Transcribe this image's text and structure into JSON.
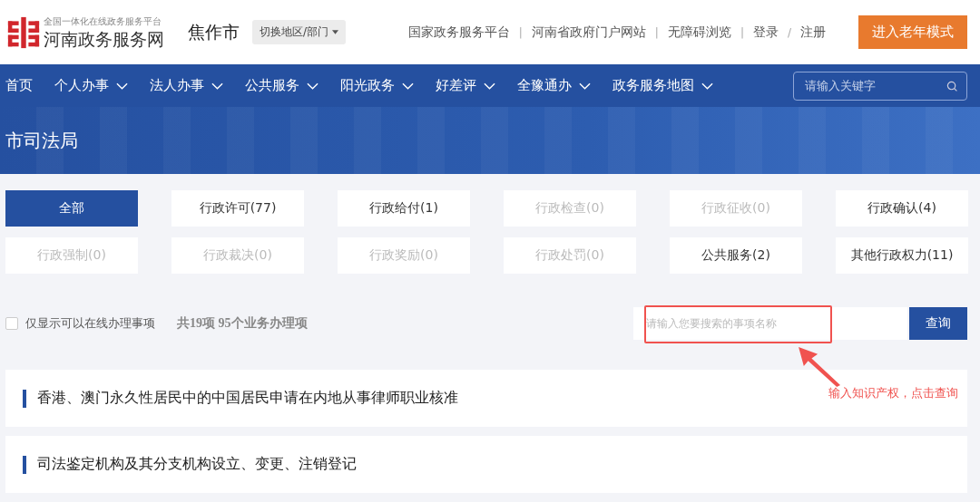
{
  "header": {
    "logo_subtitle": "全国一体化在线政务服务平台",
    "logo_title": "河南政务服务网",
    "city": "焦作市",
    "switch_button": "切换地区/部门",
    "links": [
      {
        "label": "国家政务服务平台",
        "separator": "|"
      },
      {
        "label": "河南省政府门户网站",
        "separator": "|"
      },
      {
        "label": "无障碍浏览",
        "separator": "|"
      },
      {
        "label": "登录",
        "separator": "/"
      },
      {
        "label": "注册"
      }
    ],
    "elder_button": "进入老年模式"
  },
  "nav": {
    "items": [
      {
        "label": "首页",
        "dropdown": false
      },
      {
        "label": "个人办事",
        "dropdown": true
      },
      {
        "label": "法人办事",
        "dropdown": true
      },
      {
        "label": "公共服务",
        "dropdown": true
      },
      {
        "label": "阳光政务",
        "dropdown": true
      },
      {
        "label": "好差评",
        "dropdown": true
      },
      {
        "label": "全豫通办",
        "dropdown": true
      },
      {
        "label": "政务服务地图",
        "dropdown": true
      }
    ],
    "search": {
      "placeholder": "请输入关键字"
    }
  },
  "banner": {
    "title": "市司法局"
  },
  "categories": [
    {
      "label": "全部",
      "selected": true,
      "disabled": false
    },
    {
      "label": "行政许可(77)",
      "selected": false,
      "disabled": false
    },
    {
      "label": "行政给付(1)",
      "selected": false,
      "disabled": false
    },
    {
      "label": "行政检查(0)",
      "selected": false,
      "disabled": true
    },
    {
      "label": "行政征收(0)",
      "selected": false,
      "disabled": true
    },
    {
      "label": "行政确认(4)",
      "selected": false,
      "disabled": false
    },
    {
      "label": "行政强制(0)",
      "selected": false,
      "disabled": true
    },
    {
      "label": "行政裁决(0)",
      "selected": false,
      "disabled": true
    },
    {
      "label": "行政奖励(0)",
      "selected": false,
      "disabled": true
    },
    {
      "label": "行政处罚(0)",
      "selected": false,
      "disabled": true
    },
    {
      "label": "公共服务(2)",
      "selected": false,
      "disabled": false
    },
    {
      "label": "其他行政权力(11)",
      "selected": false,
      "disabled": false
    }
  ],
  "filter": {
    "online_only": {
      "label": "仅显示可以在线办理事项",
      "checked": false
    },
    "summary": "共19项 95个业务办理项"
  },
  "search": {
    "placeholder": "请输入您要搜索的事项名称",
    "button": "查询"
  },
  "annotation": {
    "text": "输入知识产权，点击查询"
  },
  "items": [
    {
      "title": "香港、澳门永久性居民中的中国居民申请在内地从事律师职业核准"
    },
    {
      "title": "司法鉴定机构及其分支机构设立、变更、注销登记"
    }
  ]
}
